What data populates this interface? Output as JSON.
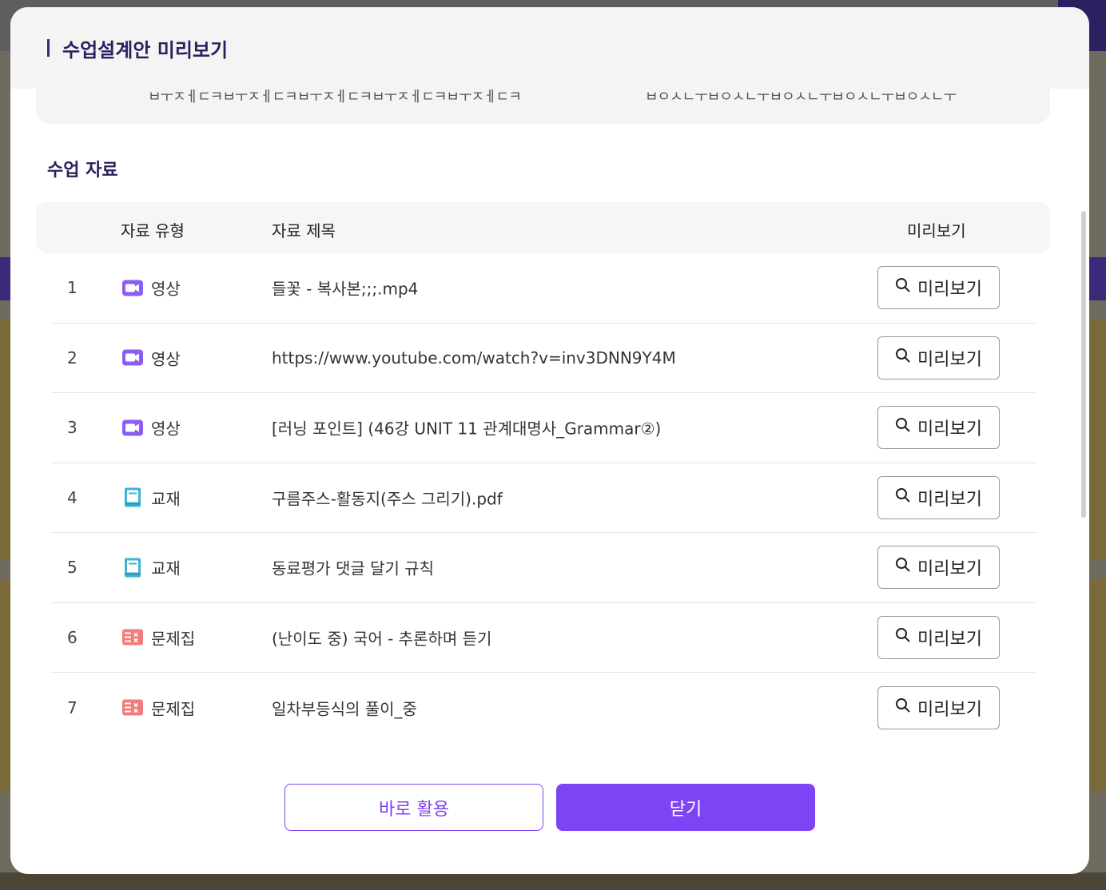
{
  "modal": {
    "title": "수업설계안 미리보기",
    "prev_text_left": "ㅂㅜㅈㅔㄷㅋㅂㅜㅈㅔㄷㅋㅂㅜㅈㅔㄷㅋㅂㅜㅈㅔㄷㅋㅂㅜㅈㅔㄷㅋ",
    "prev_text_right": "ㅂㅇㅅㄴㅜㅂㅇㅅㄴㅜㅂㅇㅅㄴㅜㅂㅇㅅㄴㅜㅂㅇㅅㄴㅜ",
    "section_title": "수업 자료",
    "columns": {
      "type": "자료 유형",
      "title": "자료 제목",
      "preview": "미리보기"
    },
    "rows": [
      {
        "num": "1",
        "type": "영상",
        "icon": "video-icon",
        "title": "들꽃 - 복사본;;;.mp4",
        "button": "미리보기"
      },
      {
        "num": "2",
        "type": "영상",
        "icon": "video-icon",
        "title": "https://www.youtube.com/watch?v=inv3DNN9Y4M",
        "button": "미리보기"
      },
      {
        "num": "3",
        "type": "영상",
        "icon": "video-icon",
        "title": "[러닝 포인트] (46강 UNIT 11 관계대명사_Grammar②)",
        "button": "미리보기"
      },
      {
        "num": "4",
        "type": "교재",
        "icon": "book-icon",
        "title": "구름주스-활동지(주스 그리기).pdf",
        "button": "미리보기"
      },
      {
        "num": "5",
        "type": "교재",
        "icon": "book-icon",
        "title": "동료평가 댓글 달기 규칙",
        "button": "미리보기"
      },
      {
        "num": "6",
        "type": "문제집",
        "icon": "workbook-icon",
        "title": "(난이도 중) 국어 - 추론하며 듣기",
        "button": "미리보기"
      },
      {
        "num": "7",
        "type": "문제집",
        "icon": "workbook-icon",
        "title": "일차부등식의 풀이_중",
        "button": "미리보기"
      }
    ],
    "buttons": {
      "use": "바로 활용",
      "close": "닫기"
    }
  },
  "colors": {
    "accent": "#7d44f5",
    "title": "#2c1f5e",
    "video_icon": "#8b5cf6",
    "book_icon": "#3bb4d4",
    "workbook_icon": "#f27c7c"
  }
}
